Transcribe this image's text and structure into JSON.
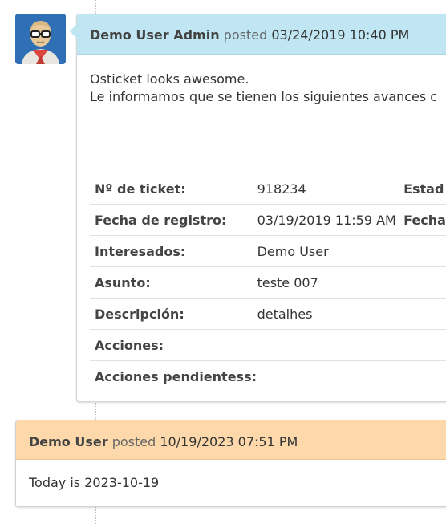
{
  "colors": {
    "staff_header": "#bfe6f2",
    "user_header": "#fcd8ab",
    "avatar_bg": "#2f6fb6"
  },
  "entry1": {
    "avatar_icon": "staff-avatar-icon",
    "author": "Demo User Admin",
    "posted_word": "posted",
    "datetime": "03/24/2019 10:40 PM",
    "body_lines": [
      "Osticket looks awesome.",
      "Le informamos que se tienen los siguientes avances c"
    ],
    "rows": [
      {
        "label": "Nº de ticket:",
        "value": "918234",
        "label2": "Estad"
      },
      {
        "label": "Fecha de registro:",
        "value": "03/19/2019 11:59 AM",
        "label2": "Fecha"
      },
      {
        "label": "Interesados:",
        "value": "Demo User",
        "label2": ""
      },
      {
        "label": "Asunto:",
        "value": "teste 007",
        "label2": ""
      },
      {
        "label": "Descripción:",
        "value": "detalhes",
        "label2": ""
      },
      {
        "label": "Acciones:",
        "value": "",
        "label2": ""
      },
      {
        "label": "Acciones pendientess:",
        "value": "",
        "label2": ""
      }
    ]
  },
  "entry2": {
    "author": "Demo User",
    "posted_word": "posted",
    "datetime": "10/19/2023 07:51 PM",
    "body": "Today is 2023-10-19"
  }
}
